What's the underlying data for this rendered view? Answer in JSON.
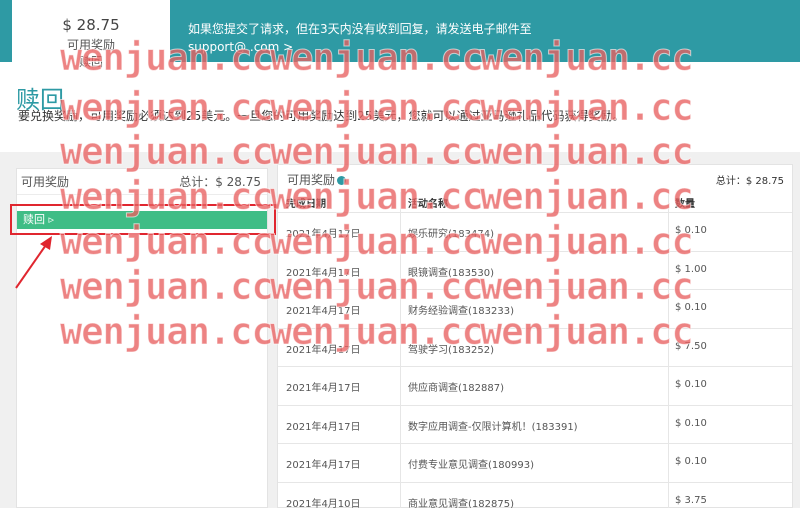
{
  "banner": {
    "balance_amount": "$ 28.75",
    "balance_label": "可用奖励",
    "balance_redeem_label": "赎回",
    "message_line1": "如果您提交了请求，但在3天内没有收到回复，请发送电子邮件至",
    "message_line2": "support@                    .com >"
  },
  "page": {
    "title": "赎回",
    "description": "要兑换奖励，可用奖励必须达到25美元。一旦您的可用奖励达到25美元，您就可以通过亚马逊礼品代码获得奖励。"
  },
  "left_panel": {
    "title": "可用奖励",
    "total": "总计：$ 28.75",
    "redeem_button": "赎回 ▹"
  },
  "right_panel": {
    "title": "可用奖励",
    "total": "总计：$ 28.75",
    "columns": {
      "date": "完成日期",
      "name": "活动名称",
      "qty": "数量"
    },
    "rows": [
      {
        "date": "2021年4月17日",
        "name": "娱乐研究(183474)",
        "qty": "$ 0.10"
      },
      {
        "date": "2021年4月17日",
        "name": "眼镜调查(183530)",
        "qty": "$ 1.00"
      },
      {
        "date": "2021年4月17日",
        "name": "财务经验调查(183233)",
        "qty": "$ 0.10"
      },
      {
        "date": "2021年4月17日",
        "name": "驾驶学习(183252)",
        "qty": "$ 7.50"
      },
      {
        "date": "2021年4月17日",
        "name": "供应商调查(182887)",
        "qty": "$ 0.10"
      },
      {
        "date": "2021年4月17日",
        "name": "数字应用调查-仅限计算机！(183391)",
        "qty": "$ 0.10"
      },
      {
        "date": "2021年4月17日",
        "name": "付费专业意见调查(180993)",
        "qty": "$ 0.10"
      },
      {
        "date": "2021年4月10日",
        "name": "商业意见调查(182875)",
        "qty": "$ 3.75"
      }
    ]
  },
  "watermark": {
    "text": "wenjuan.cc"
  },
  "colors": {
    "accent": "#2e9aa4",
    "redeem_green": "#3fbd86",
    "highlight_red": "#e0262f",
    "watermark": "#e86060"
  }
}
